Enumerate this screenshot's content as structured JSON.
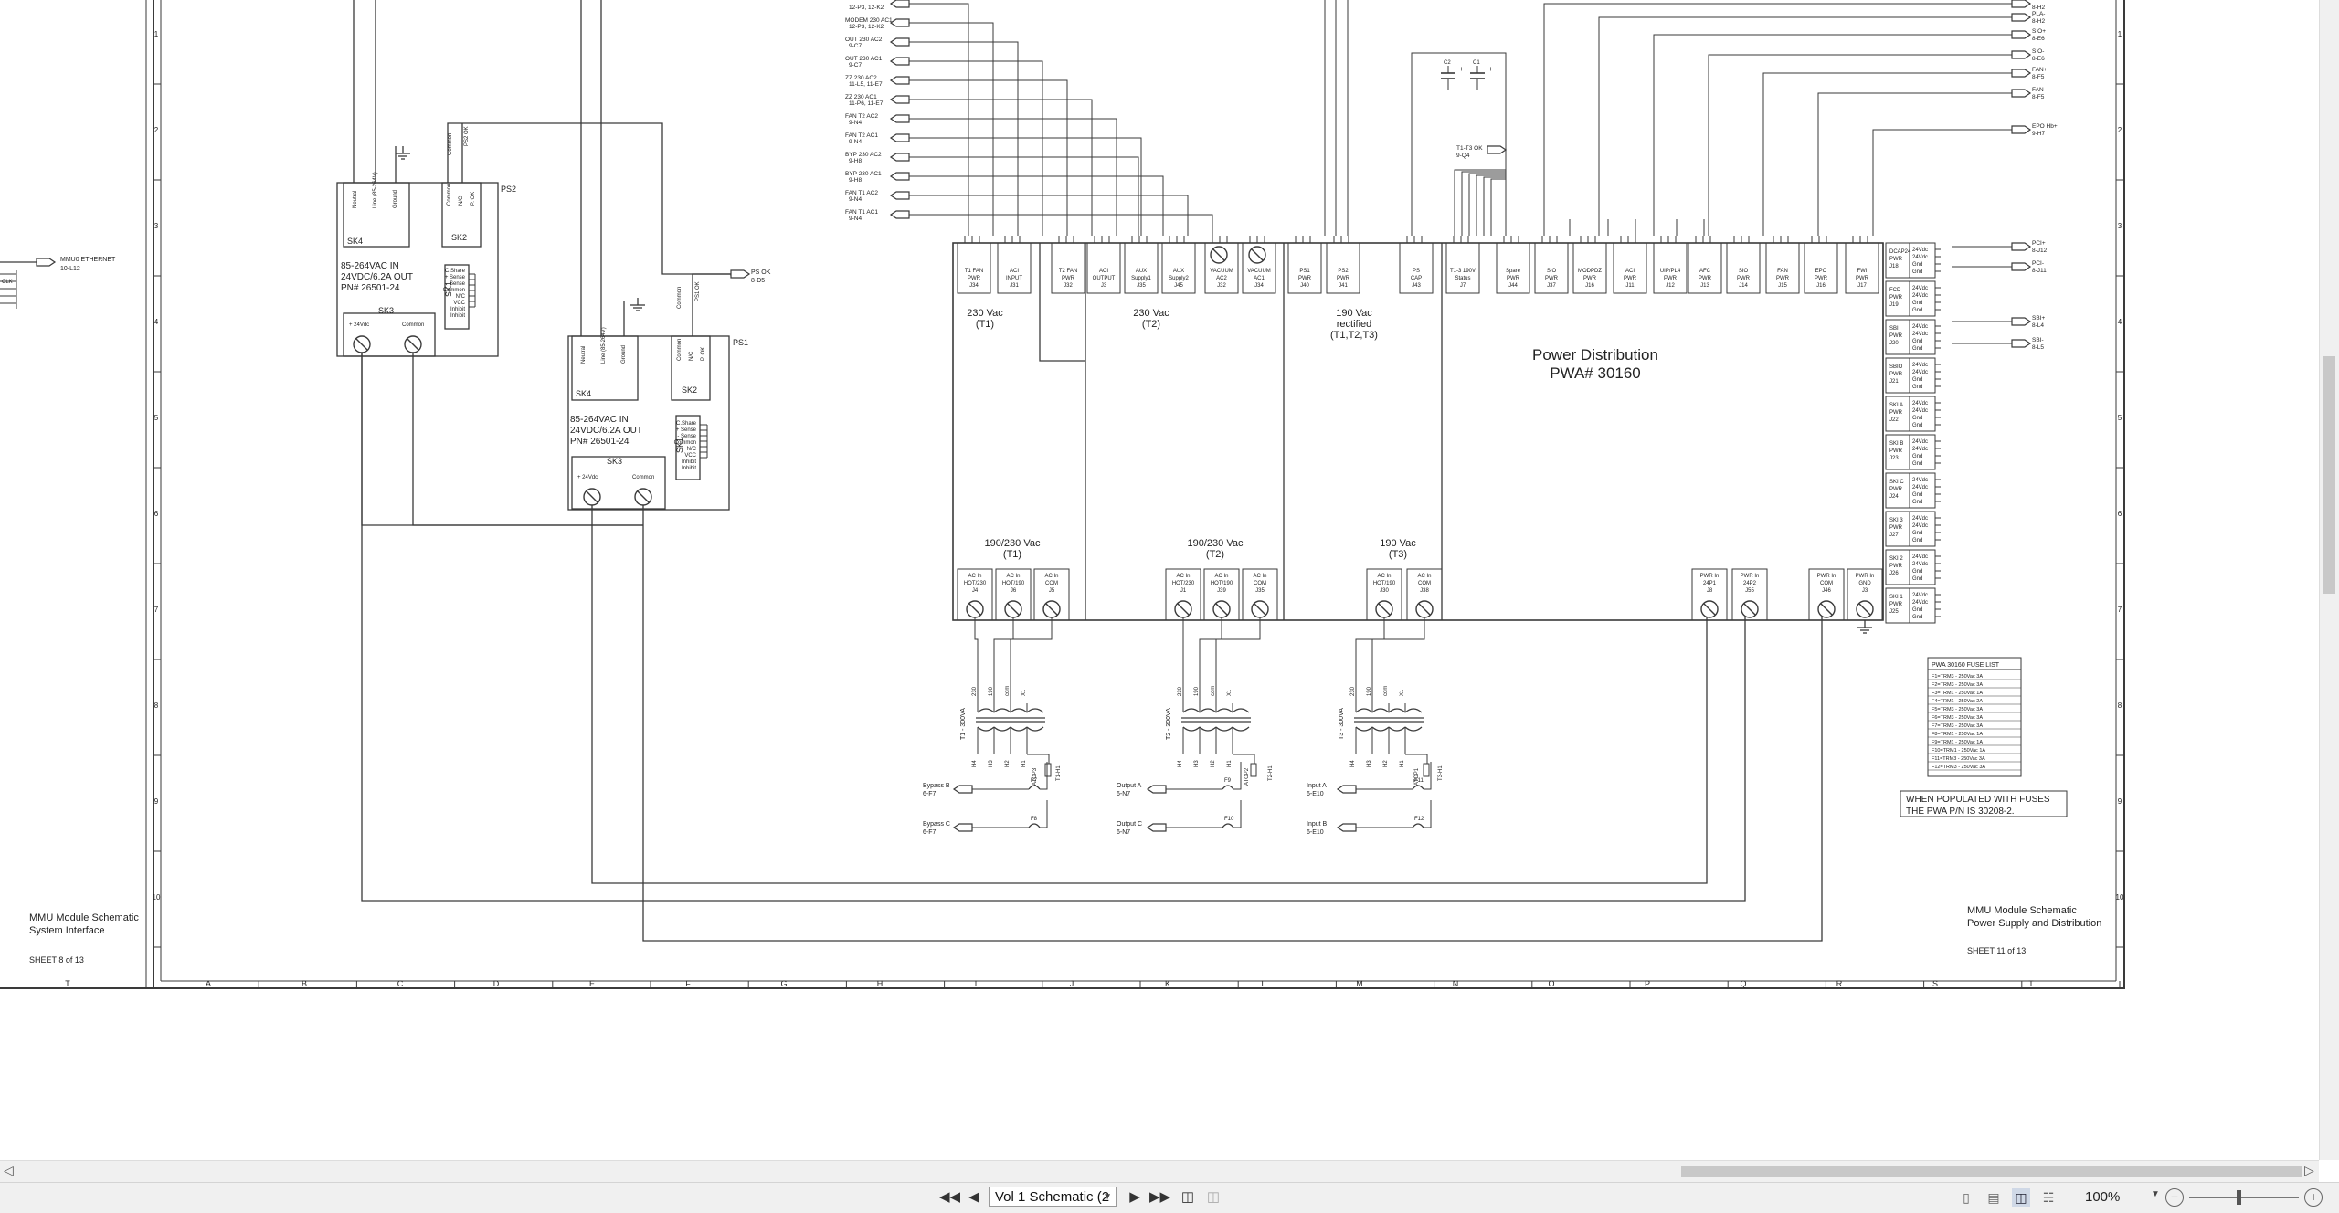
{
  "left_sheet": {
    "title_line1": "MMU Module Schematic",
    "title_line2": "System Interface",
    "sheet": "SHEET 8 of 13",
    "ethernet_label": "MMU0 ETHERNET",
    "ethernet_ref": "10-L12"
  },
  "ps2": {
    "ref": "PS2",
    "desc1": "85-264VAC IN",
    "desc2": "24VDC/6.2A OUT",
    "desc3": "PN# 26501-24",
    "sk4": "SK4",
    "sk2": "SK2",
    "sk3": "SK3",
    "sk1": "SK1",
    "sk4_pins": [
      "Neutral",
      "Line (85-264V)",
      "Ground"
    ],
    "sk2_pins": [
      "Common",
      "N/C",
      "P. OK"
    ],
    "sk1_pins": [
      "C.Share",
      "+ Sense",
      "- Sense",
      "Common",
      "N/C",
      "VCC",
      "Inhibit",
      "Inhibit"
    ],
    "out_pos": "+ 24Vdc",
    "out_neg": "Common",
    "conn_common": "Common",
    "conn_psok": "PS2 OK"
  },
  "ps1": {
    "ref": "PS1",
    "desc1": "85-264VAC IN",
    "desc2": "24VDC/6.2A OUT",
    "desc3": "PN# 26501-24",
    "sk4": "SK4",
    "sk2": "SK2",
    "sk3": "SK3",
    "sk1": "SK1",
    "sk4_pins": [
      "Neutral",
      "Line (85-264V)",
      "Ground"
    ],
    "sk2_pins": [
      "Common",
      "N/C",
      "P. OK"
    ],
    "sk1_pins": [
      "C.Share",
      "+ Sense",
      "- Sense",
      "Common",
      "N/C",
      "VCC",
      "Inhibit",
      "Inhibit"
    ],
    "out_pos": "+ 24Vdc",
    "out_neg": "Common",
    "conn_common": "Common",
    "conn_psok": "PS1 OK",
    "psok_label": "PS OK",
    "psok_ref": "8-D5"
  },
  "signal_labels": [
    {
      "name": "",
      "ref": "12-P3, 12-K2"
    },
    {
      "name": "MODEM 230 AC1",
      "ref": "12-P3, 12-K2"
    },
    {
      "name": "OUT 230 AC2",
      "ref": "9-C7"
    },
    {
      "name": "OUT 230 AC1",
      "ref": "9-C7"
    },
    {
      "name": "ZZ 230 AC2",
      "ref": "11-L5, 11-E7"
    },
    {
      "name": "ZZ 230 AC1",
      "ref": "11-P6, 11-E7"
    },
    {
      "name": "FAN T2 AC2",
      "ref": "9-N4"
    },
    {
      "name": "FAN T2 AC1",
      "ref": "9-N4"
    },
    {
      "name": "BYP 230 AC2",
      "ref": "9-H8"
    },
    {
      "name": "BYP 230 AC1",
      "ref": "9-H8"
    },
    {
      "name": "FAN T1 AC2",
      "ref": "9-N4"
    },
    {
      "name": "FAN T1 AC1",
      "ref": "9-N4"
    }
  ],
  "right_edge_labels": [
    {
      "name": "",
      "ref": "8-H2"
    },
    {
      "name": "PLA-",
      "ref": "8-H2"
    },
    {
      "name": "SIO+",
      "ref": "8-E6"
    },
    {
      "name": "SIO-",
      "ref": "8-E6"
    },
    {
      "name": "FAN+",
      "ref": "8-F5"
    },
    {
      "name": "FAN-",
      "ref": "8-F5"
    },
    {
      "name": "EPO Hb+",
      "ref": "9-H7"
    },
    {
      "name": "PCI+",
      "ref": "8-J12"
    },
    {
      "name": "PCI-",
      "ref": "8-J11"
    },
    {
      "name": "SBI+",
      "ref": "8-L4"
    },
    {
      "name": "SBI-",
      "ref": "8-L5"
    }
  ],
  "t1t1_ok": {
    "name": "T1-T3 OK",
    "ref": "9-Q4"
  },
  "top_headers": [
    {
      "l1": "T1 FAN",
      "l2": "PWR",
      "l3": "J34"
    },
    {
      "l1": "ACI",
      "l2": "INPUT",
      "l3": "J31"
    },
    {
      "l1": "T2 FAN",
      "l2": "PWR",
      "l3": "J32"
    },
    {
      "l1": "ACI",
      "l2": "OUTPUT",
      "l3": "J3"
    },
    {
      "l1": "AUX",
      "l2": "Supply1",
      "l3": "J35"
    },
    {
      "l1": "AUX",
      "l2": "Supply2",
      "l3": "J45"
    },
    {
      "l1": "VACUUM",
      "l2": "AC2",
      "l3": "J32"
    },
    {
      "l1": "VACUUM",
      "l2": "AC1",
      "l3": "J34"
    },
    {
      "l1": "PS1",
      "l2": "PWR",
      "l3": "J40"
    },
    {
      "l1": "PS2",
      "l2": "PWR",
      "l3": "J41"
    },
    {
      "l1": "PS",
      "l2": "CAP",
      "l3": "J43"
    },
    {
      "l1": "T1-3 190V",
      "l2": "Status",
      "l3": "J7"
    },
    {
      "l1": "Spare",
      "l2": "PWR",
      "l3": "J44"
    },
    {
      "l1": "SIO",
      "l2": "PWR",
      "l3": "J37"
    },
    {
      "l1": "MODPDZ",
      "l2": "PWR",
      "l3": "J16"
    },
    {
      "l1": "ACI",
      "l2": "PWR",
      "l3": "J11"
    },
    {
      "l1": "UIP/PL4",
      "l2": "PWR",
      "l3": "J12"
    },
    {
      "l1": "AFC",
      "l2": "PWR",
      "l3": "J13"
    },
    {
      "l1": "SIO",
      "l2": "PWR",
      "l3": "J14"
    },
    {
      "l1": "FAN",
      "l2": "PWR",
      "l3": "J15"
    },
    {
      "l1": "EPO",
      "l2": "PWR",
      "l3": "J16"
    },
    {
      "l1": "FWI",
      "l2": "PWR",
      "l3": "J17"
    }
  ],
  "voltage_labels": [
    {
      "l1": "230 Vac",
      "l2": "(T1)"
    },
    {
      "l1": "230 Vac",
      "l2": "(T2)"
    },
    {
      "l1": "190 Vac",
      "l2": "rectified",
      "l3": "(T1,T2,T3)"
    },
    {
      "l1": "190/230 Vac",
      "l2": "(T1)"
    },
    {
      "l1": "190/230 Vac",
      "l2": "(T2)"
    },
    {
      "l1": "190 Vac",
      "l2": "(T3)"
    }
  ],
  "pd_title": "Power Distribution",
  "pd_pwa": "PWA# 30160",
  "side_headers": [
    {
      "l1": "DCAP24",
      "l2": "PWR",
      "l3": "J18"
    },
    {
      "l1": "FCD",
      "l2": "PWR",
      "l3": "J19"
    },
    {
      "l1": "SBI",
      "l2": "PWR",
      "l3": "J20"
    },
    {
      "l1": "SBIO",
      "l2": "PWR",
      "l3": "J21"
    },
    {
      "l1": "SKI A",
      "l2": "PWR",
      "l3": "J22"
    },
    {
      "l1": "SKI B",
      "l2": "PWR",
      "l3": "J23"
    },
    {
      "l1": "SKI C",
      "l2": "PWR",
      "l3": "J24"
    },
    {
      "l1": "SKI 3",
      "l2": "PWR",
      "l3": "J27"
    },
    {
      "l1": "SKI 2",
      "l2": "PWR",
      "l3": "J26"
    },
    {
      "l1": "SKI 1",
      "l2": "PWR",
      "l3": "J25"
    }
  ],
  "side_pins": [
    "24Vdc",
    "24Vdc",
    "Gnd",
    "Gnd"
  ],
  "bottom_terms": [
    {
      "l1": "AC In",
      "l2": "HOT/230",
      "l3": "J4"
    },
    {
      "l1": "AC In",
      "l2": "HOT/190",
      "l3": "J6"
    },
    {
      "l1": "AC In",
      "l2": "COM",
      "l3": "J5"
    },
    {
      "l1": "AC In",
      "l2": "HOT/230",
      "l3": "J1"
    },
    {
      "l1": "AC In",
      "l2": "HOT/190",
      "l3": "J39"
    },
    {
      "l1": "AC In",
      "l2": "COM",
      "l3": "J35"
    },
    {
      "l1": "AC In",
      "l2": "HOT/190",
      "l3": "J30"
    },
    {
      "l1": "AC In",
      "l2": "COM",
      "l3": "J38"
    },
    {
      "l1": "PWR In",
      "l2": "24P1",
      "l3": "J8"
    },
    {
      "l1": "PWR In",
      "l2": "24P2",
      "l3": "J55"
    },
    {
      "l1": "PWR In",
      "l2": "COM",
      "l3": "J46"
    },
    {
      "l1": "PWR In",
      "l2": "GND",
      "l3": "J3"
    }
  ],
  "transformers": [
    {
      "name": "T1 - 300VA",
      "pins": [
        "230",
        "190",
        "com",
        "X1"
      ],
      "sec": [
        "H4",
        "H3",
        "H2",
        "H1"
      ]
    },
    {
      "name": "T2 - 300VA",
      "pins": [
        "230",
        "190",
        "com",
        "X1"
      ],
      "sec": [
        "H4",
        "H3",
        "H2",
        "H1"
      ]
    },
    {
      "name": "T3 - 300VA",
      "pins": [
        "230",
        "190",
        "com",
        "X1"
      ],
      "sec": [
        "H4",
        "H3",
        "H2",
        "H1"
      ]
    }
  ],
  "fuses": [
    "F7",
    "F8",
    "F9",
    "F10",
    "F11",
    "F12"
  ],
  "thermals": [
    "ATOP3",
    "T1-H1",
    "ATOP2",
    "T2-H1",
    "ATOP1",
    "T3-H1"
  ],
  "input_labels": [
    {
      "name": "Bypass B",
      "ref": "6-F7"
    },
    {
      "name": "Bypass C",
      "ref": "6-F7"
    },
    {
      "name": "Output A",
      "ref": "6-N7"
    },
    {
      "name": "Output C",
      "ref": "6-N7"
    },
    {
      "name": "Input A",
      "ref": "6-E10"
    },
    {
      "name": "Input B",
      "ref": "6-E10"
    }
  ],
  "fuse_list": {
    "title": "PWA 30160 FUSE LIST",
    "rows": [
      "F1=TRM3 - 250Vac 3A",
      "F2=TRM3 - 250Vac 3A",
      "F3=TRM1 - 250Vac 1A",
      "F4=TRM1 - 250Vac 2A",
      "F5=TRM3 - 250Vac 3A",
      "F6=TRM3 - 250Vac 3A",
      "F7=TRM3 - 250Vac 3A",
      "F8=TRM1 - 250Vac 1A",
      "F9=TRM1 - 250Vac 1A",
      "F10=TRM1 - 250Vac 1A",
      "F11=TRM3 - 250Vac 3A",
      "F12=TRM3 - 250Vac 3A"
    ]
  },
  "fuse_note": {
    "l1": "WHEN POPULATED WITH FUSES",
    "l2": "THE PWA P/N IS 30208-2."
  },
  "right_sheet": {
    "title_line1": "MMU Module Schematic",
    "title_line2": "Power Supply and Distribution",
    "sheet": "SHEET 11 of 13"
  },
  "zone_letters": [
    "A",
    "B",
    "C",
    "D",
    "E",
    "F",
    "G",
    "H",
    "I",
    "J",
    "K",
    "L",
    "M",
    "N",
    "O",
    "P",
    "Q",
    "R",
    "S",
    "T"
  ],
  "left_zone_letter": "T",
  "zone_numbers": [
    "1",
    "2",
    "3",
    "4",
    "5",
    "6",
    "7",
    "8",
    "9",
    "10"
  ],
  "statusbar": {
    "doc_name": "Vol 1 Schematic (2",
    "zoom": "100%"
  },
  "colors": {
    "line": "#3a3a3a",
    "background": "#ffffff",
    "chrome": "#f0f0f0",
    "active_view": "#cfd8e6"
  },
  "icons": {
    "first_page": "first-page-icon",
    "prev_page": "prev-page-icon",
    "next_page": "next-page-icon",
    "last_page": "last-page-icon",
    "split": "split-view-icon",
    "zoom_out": "zoom-out-icon",
    "zoom_in": "zoom-in-icon"
  }
}
